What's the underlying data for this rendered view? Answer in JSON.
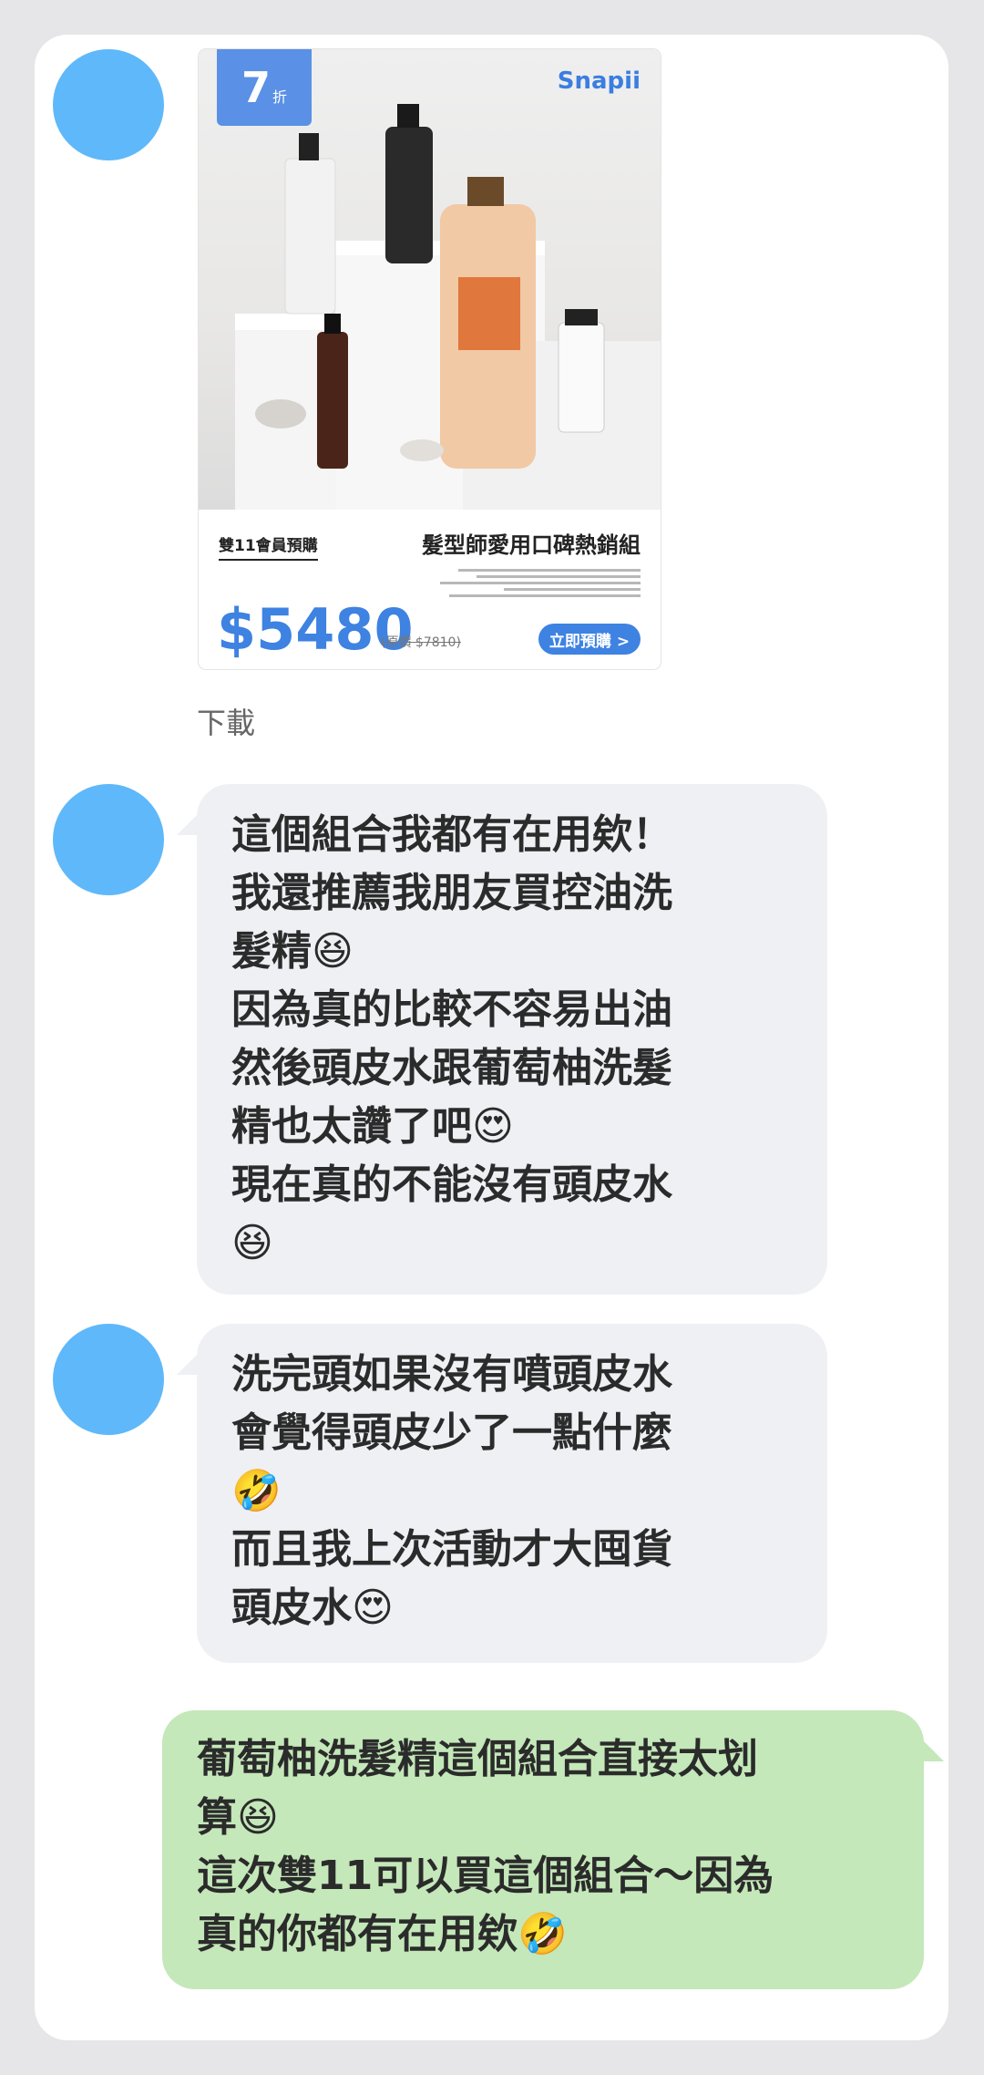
{
  "promo_card": {
    "discount_number": "7",
    "discount_unit": "折",
    "brand": "Snapii",
    "tag": "雙11會員預購",
    "title": "髮型師愛用口碑熱銷組",
    "price": "$5480",
    "original_price": "(原價 $7810)",
    "cta": "立即預購 >"
  },
  "download_label": "下載",
  "messages": [
    {
      "side": "incoming",
      "text": "這個組合我都有在用欸！\n我還推薦我朋友買控油洗\n髮精😆\n因為真的比較不容易出油\n然後頭皮水跟葡萄柚洗髮\n精也太讚了吧😍\n現在真的不能沒有頭皮水\n😆"
    },
    {
      "side": "incoming",
      "text": "洗完頭如果沒有噴頭皮水\n會覺得頭皮少了一點什麼\n🤣\n而且我上次活動才大囤貨\n頭皮水😍"
    },
    {
      "side": "outgoing",
      "text": "葡萄柚洗髮精這個組合直接太划\n算😆\n這次雙11可以買這個組合～因為\n真的你都有在用欸🤣"
    }
  ],
  "colors": {
    "avatar": "#5fb8f9",
    "incoming_bubble": "#eef0f4",
    "outgoing_bubble": "#c4e8b9",
    "promo_accent": "#3e82e2"
  }
}
